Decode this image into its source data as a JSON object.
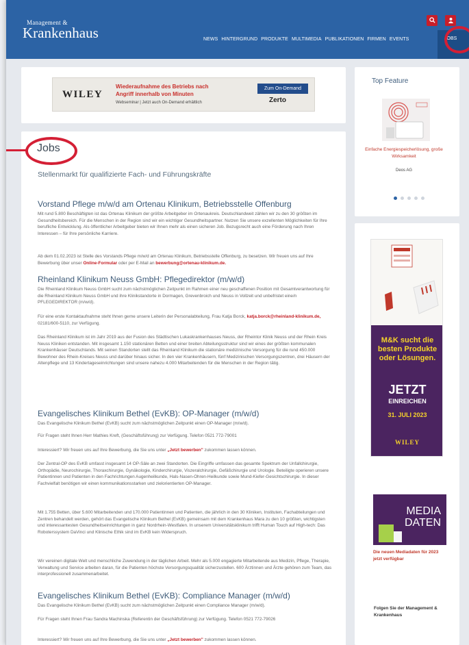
{
  "header": {
    "logo_small": "Management &",
    "logo_big": "Krankenhaus",
    "nav": [
      "NEWS",
      "HINTERGRUND",
      "PRODUKTE",
      "MULTIMEDIA",
      "PUBLIKATIONEN",
      "FIRMEN",
      "EVENTS"
    ],
    "active_nav": "JOBS",
    "icons": [
      "search-icon",
      "user-icon"
    ]
  },
  "banner": {
    "brand": "WILEY",
    "line1": "Wiederaufnahme des Betriebs nach",
    "line2": "Angriff innerhalb von Minuten",
    "line3": "Webseminar | Jetzt auch On-Demand erhältlich",
    "button": "Zum On-Demand",
    "partner": "Zerto"
  },
  "main": {
    "title": "Jobs",
    "subtitle": "Stellenmarkt für qualifizierte Fach- und Führungskräfte",
    "jobs": [
      {
        "title": "Vorstand Pflege m/w/d am Ortenau Klinikum, Betriebsstelle Offenburg",
        "p1": "Mit rund 5.800 Beschäftigten ist das Ortenau Klinikum der größte Arbeitgeber im Ortenaukreis. Deutschlandweit zählen wir zu den 30 größten im Gesundheitsbereich. Für die Menschen in der Region sind wir ein wichtiger Gesundheitspartner. Nutzen Sie unsere exzellenten Möglichkeiten für Ihre berufliche Entwicklung. Als öffentlicher Arbeitgeber bieten wir Ihnen mehr als einen sicheren Job. Bezugsrecht auch eine Förderung nach Ihren Interessen – für Ihre persönliche Karriere.",
        "p2a": "Ab dem 01.02.2023 ist Stelle des Vorstands Pflege m/w/d am Ortenau Klinikum, Betriebsstelle Offenburg, zu besetzen. Wir freuen uns auf Ihre Bewerbung über unser ",
        "p2_link": "Online-Formular",
        "p2b": " oder per E-Mail an ",
        "p2_mail": "bewerbung@ortenau-klinikum.de."
      },
      {
        "title": "Rheinland Klinikum Neuss GmbH: Pflegedirektor (m/w/d)",
        "p1": "Die Rheinland Klinikum Neuss GmbH sucht zum nächstmöglichen Zeitpunkt im Rahmen einer neu geschaffenen Position mit Gesamtverantwortung für die Rheinland Klinikum Neuss GmbH und ihre Klinikstandorte in Dormagen, Grevenbroich und Neuss in Vollzeit und unbefristet eine/n PFLEGEDIREKTOR (m/w/d).",
        "p2a": "Für eine erste Kontaktaufnahme steht Ihnen gerne unsere Leiterin der Personalabteilung, Frau Katja Borck, ",
        "p2_mail": "katja.borck@rheinland-klinikum.de,",
        "p2b": " 02181/600-5110, zur Verfügung.",
        "p3": "Das Rheinland Klinikum ist im Jahr 2019 aus der Fusion des Städtischen Lukaskrankenhauses Neuss, der Rheintor Klinik Neuss und der Rhein Kreis Neuss Kliniken entstanden. Mit insgesamt 1.150 stationären Betten und einer breiten Abteilungsstruktur sind wir eines der größten kommunalen Krankenhäuser Deutschlands. Mit seinen Standorten stellt das Rheinland Klinikum die stationäre medizinische Versorgung für die rund 450.000 Bewohner des Rhein-Kreises Neuss und darüber hinaus sicher. In den vier Krankenhäusern, fünf Medizinischen Versorgungszentren, drei Häusern der Altenpflege und 13 Kindertageseinrichtungen sind unsere nahezu 4.000 Mitarbeitenden für die Menschen in der Region tätig."
      },
      {
        "title": "Evangelisches Klinikum Bethel (EvKB): OP-Manager (m/w/d)",
        "p1": "Das Evangelische Klinikum Bethel (EvKB) sucht zum nächstmöglichen Zeitpunkt einen OP-Manager (m/w/d).",
        "p2": "Für Fragen steht Ihnen Herr Mathies Kreft, (Geschäftsführung) zur Verfügung. Telefon 0521 772-79001",
        "p3a": "Interessiert? Wir freuen uns auf Ihre Bewerbung, die Sie uns unter ",
        "p3_link": "„Jetzt bewerben\"",
        "p3b": " zukommen lassen können.",
        "p4": "Der Zentral-OP des EvKB umfasst insgesamt 14 OP-Säle an zwei Standorten. Die Eingriffe umfassen das gesamte Spektrum der Unfallchirurgie, Orthopädie, Neurochirurgie, Thoraxchirurgie, Gynäkologie, Kinderchirurgie, Viszeralchirurgie, Gefäßchirurgie und Urologie. Beteiligte operieren unsere Patientinnen und Patienten in den Fachrichtungen Augenheilkunde, Hals-Nasen-Ohren-Heilkunde sowie Mund-Kiefer-Gesichtschirurgie. In dieser Fachvielfalt benötigen wir einen kommunikationsstarken und zielorientierten OP-Manager.",
        "p5": "Mit 1.755 Betten, über 5.600 Mitarbeitenden und 170.000 Patientinnen und Patienten, die jährlich in den 30 Kliniken, Instituten, Fachabteilungen und Zentren behandelt werden, gehört das Evangelische Klinikum Bethel (EvKB) gemeinsam mit dem Krankenhaus Mara zu den 10 größten, wichtigsten und interessantesten Gesundheitseinrichtungen in ganz Nordrhein-Westfalen. In unserem Universitätsklinikum trifft Human Touch auf High-tech: Das Roboterssystem DaVinci und Klinische Ethik sind im EvKB kein Widerspruch.",
        "p6": "Wir vereinen digitale Welt und menschliche Zuwendung in der täglichen Arbeit. Mehr als 5.000 engagierte Mitarbeitende aus Medizin, Pflege, Therapie, Verwaltung und Service arbeiten daran, für die Patienten höchste Versorgungsqualität sicherzustellen. 600 Ärztinnen und Ärzte gehören zum Team, das interprofessionell zusammenarbeitet."
      },
      {
        "title": "Evangelisches Klinikum Bethel (EvKB): Compliance Manager (m/w/d)",
        "p1": "Das Evangelische Klinikum Bethel (EvKB) sucht zum nächstmöglichen Zeitpunkt einen Compliance Manager (m/w/d).",
        "p2": "Für Fragen steht Ihnen Frau Sandra Machinska (Referentin der Geschäftsführung) zur Verfügung. Telefon 0521 772-79026",
        "p3a": "Interessiert? Wir freuen uns auf Ihre Bewerbung, die Sie uns unter ",
        "p3_link": "„Jetzt bewerben\"",
        "p3b": " zukommen lassen können."
      }
    ]
  },
  "sidebar": {
    "top_feature_title": "Top Feature",
    "feature_caption": "Einfache Energiespeicherlösung, große Wirksamkeit",
    "feature_author": "Deos AG",
    "ad": {
      "title": "M&K sucht die besten Produkte oder Lösungen.",
      "jetzt": "JETZT",
      "einreichen": "EINREICHEN",
      "date": "31. JULI 2023",
      "brand": "WILEY"
    },
    "mediadaten_line1": "MEDIA",
    "mediadaten_line2": "DATEN",
    "mediadaten_caption": "Die neuen Mediadaten für 2023 jetzt verfügbar",
    "follow_text": "Folgen Sie der Management & Krankenhaus"
  },
  "colors": {
    "header": "#2c63a5",
    "accent_red": "#c32027",
    "highlight_ring": "#d41f35",
    "ad_purple": "#4b2460"
  }
}
